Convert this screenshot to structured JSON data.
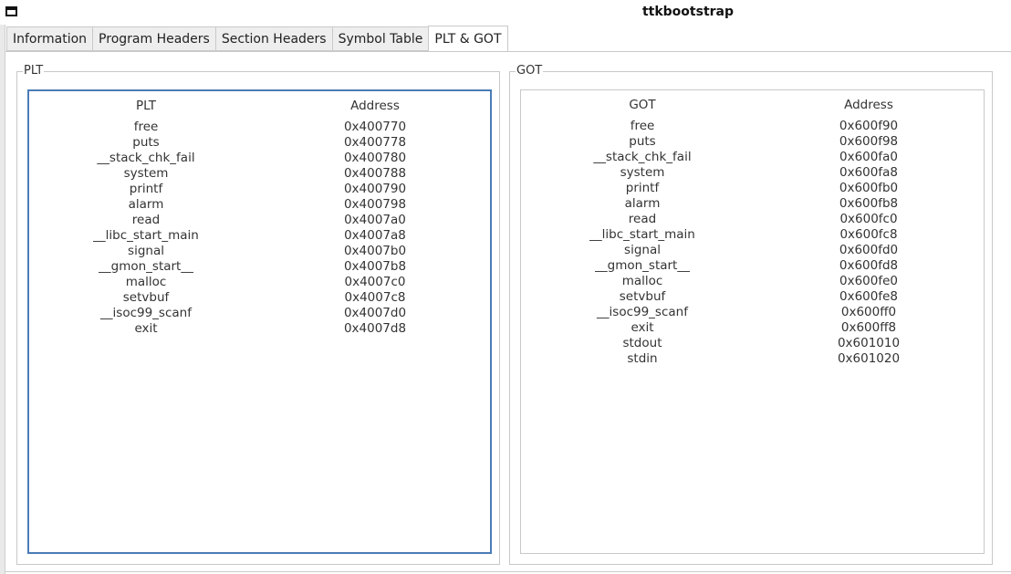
{
  "window": {
    "title": "ttkbootstrap"
  },
  "tabs": [
    {
      "label": "Information",
      "active": false
    },
    {
      "label": "Program Headers",
      "active": false
    },
    {
      "label": "Section Headers",
      "active": false
    },
    {
      "label": "Symbol Table",
      "active": false
    },
    {
      "label": "PLT & GOT",
      "active": true
    }
  ],
  "plt": {
    "frame_label": "PLT",
    "header_name": "PLT",
    "header_address": "Address",
    "rows": [
      {
        "name": "free",
        "address": "0x400770"
      },
      {
        "name": "puts",
        "address": "0x400778"
      },
      {
        "name": "__stack_chk_fail",
        "address": "0x400780"
      },
      {
        "name": "system",
        "address": "0x400788"
      },
      {
        "name": "printf",
        "address": "0x400790"
      },
      {
        "name": "alarm",
        "address": "0x400798"
      },
      {
        "name": "read",
        "address": "0x4007a0"
      },
      {
        "name": "__libc_start_main",
        "address": "0x4007a8"
      },
      {
        "name": "signal",
        "address": "0x4007b0"
      },
      {
        "name": "__gmon_start__",
        "address": "0x4007b8"
      },
      {
        "name": "malloc",
        "address": "0x4007c0"
      },
      {
        "name": "setvbuf",
        "address": "0x4007c8"
      },
      {
        "name": "__isoc99_scanf",
        "address": "0x4007d0"
      },
      {
        "name": "exit",
        "address": "0x4007d8"
      }
    ]
  },
  "got": {
    "frame_label": "GOT",
    "header_name": "GOT",
    "header_address": "Address",
    "rows": [
      {
        "name": "free",
        "address": "0x600f90"
      },
      {
        "name": "puts",
        "address": "0x600f98"
      },
      {
        "name": "__stack_chk_fail",
        "address": "0x600fa0"
      },
      {
        "name": "system",
        "address": "0x600fa8"
      },
      {
        "name": "printf",
        "address": "0x600fb0"
      },
      {
        "name": "alarm",
        "address": "0x600fb8"
      },
      {
        "name": "read",
        "address": "0x600fc0"
      },
      {
        "name": "__libc_start_main",
        "address": "0x600fc8"
      },
      {
        "name": "signal",
        "address": "0x600fd0"
      },
      {
        "name": "__gmon_start__",
        "address": "0x600fd8"
      },
      {
        "name": "malloc",
        "address": "0x600fe0"
      },
      {
        "name": "setvbuf",
        "address": "0x600fe8"
      },
      {
        "name": "__isoc99_scanf",
        "address": "0x600ff0"
      },
      {
        "name": "exit",
        "address": "0x600ff8"
      },
      {
        "name": "stdout",
        "address": "0x601010"
      },
      {
        "name": "stdin",
        "address": "0x601020"
      }
    ]
  }
}
